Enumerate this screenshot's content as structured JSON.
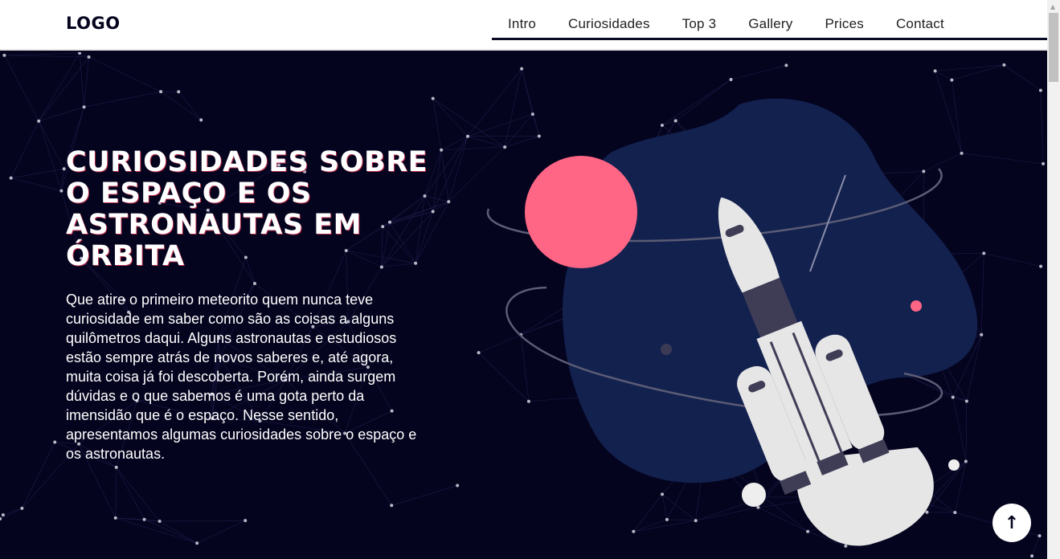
{
  "header": {
    "logo": "LOGO",
    "nav": [
      "Intro",
      "Curiosidades",
      "Top 3",
      "Gallery",
      "Prices",
      "Contact"
    ]
  },
  "hero": {
    "title": "CURIOSIDADES SOBRE O ESPAÇO E OS ASTRONAUTAS EM ÓRBITA",
    "text": "Que atire o primeiro meteorito quem nunca teve curiosidade em saber como são as coisas a alguns quilômetros daqui. Alguns astronautas e estudiosos estão sempre atrás de novos saberes e, até agora, muita coisa já foi descoberta. Porém, ainda surgem dúvidas e o que sabemos é uma gota perto da imensidão que é o espaço. Nesse sentido, apresentamos algumas curiosidades sobre o espaço e os astronautas."
  },
  "colors": {
    "background": "#05041f",
    "blob": "#13214f",
    "planet": "#ff6584"
  },
  "back_to_top": {
    "icon": "arrow-up-icon",
    "label": "↑"
  }
}
